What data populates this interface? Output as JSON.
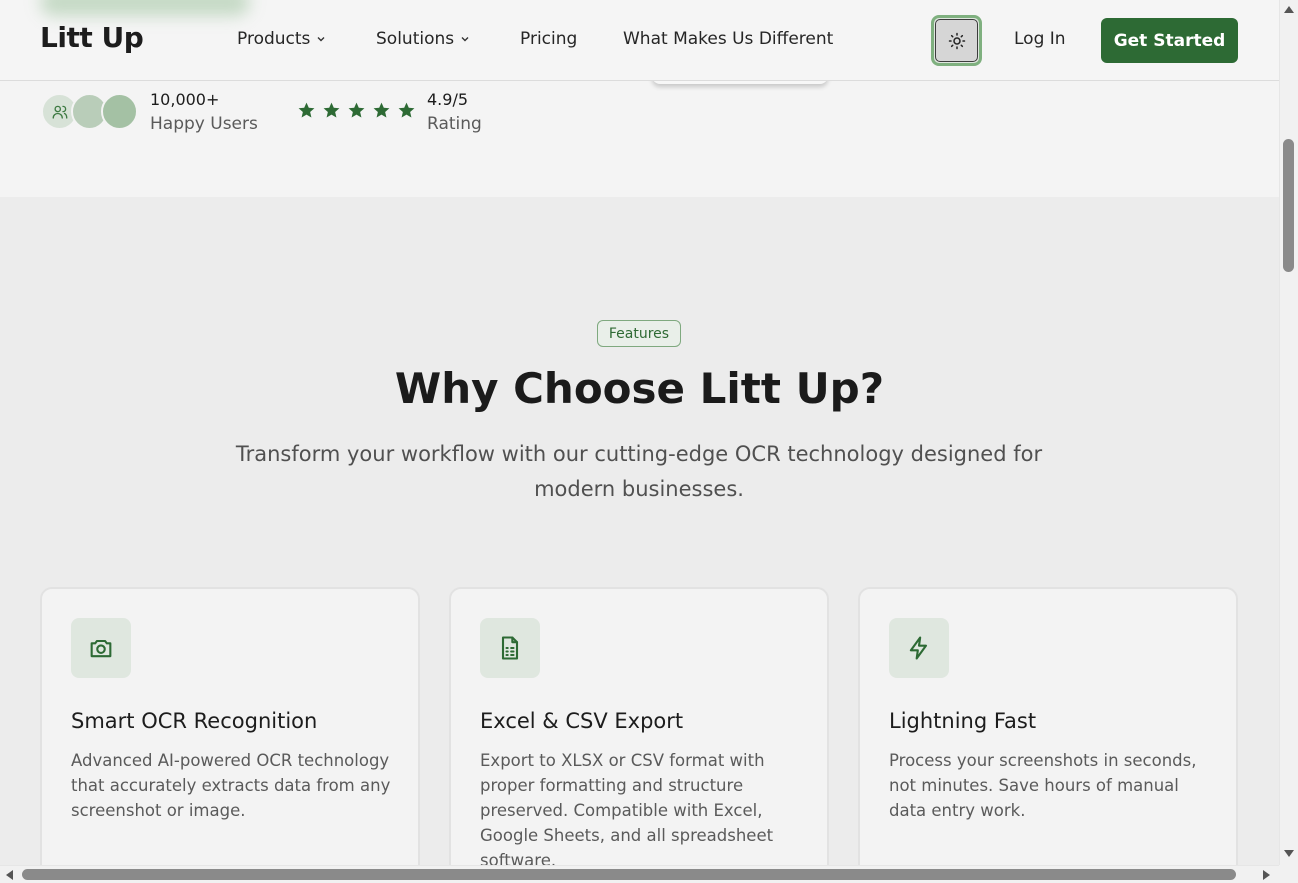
{
  "header": {
    "logo": "Litt Up",
    "nav": [
      {
        "label": "Products",
        "has_dropdown": true
      },
      {
        "label": "Solutions",
        "has_dropdown": true
      },
      {
        "label": "Pricing",
        "has_dropdown": false
      },
      {
        "label": "What Makes Us Different",
        "has_dropdown": false
      }
    ],
    "theme_toggle_icon": "sun-icon",
    "login_label": "Log In",
    "cta_label": "Get Started"
  },
  "stats": {
    "users_count": "10,000+",
    "users_label": "Happy Users",
    "rating_value": "4.9/5",
    "rating_label": "Rating",
    "stars": 5
  },
  "features": {
    "badge": "Features",
    "title": "Why Choose Litt Up?",
    "subtitle": "Transform your workflow with our cutting-edge OCR technology designed for modern businesses.",
    "cards": [
      {
        "icon": "camera-icon",
        "title": "Smart OCR Recognition",
        "text": "Advanced AI-powered OCR technology that accurately extracts data from any screenshot or image."
      },
      {
        "icon": "spreadsheet-file-icon",
        "title": "Excel & CSV Export",
        "text": "Export to XLSX or CSV format with proper formatting and structure preserved. Compatible with Excel, Google Sheets, and all spreadsheet software."
      },
      {
        "icon": "lightning-icon",
        "title": "Lightning Fast",
        "text": "Process your screenshots in seconds, not minutes. Save hours of manual data entry work."
      }
    ]
  },
  "colors": {
    "brand_green": "#2d6a34",
    "accent_light_green": "#dfe7df",
    "page_bg": "#f4f4f4",
    "section_bg": "#ececec"
  }
}
